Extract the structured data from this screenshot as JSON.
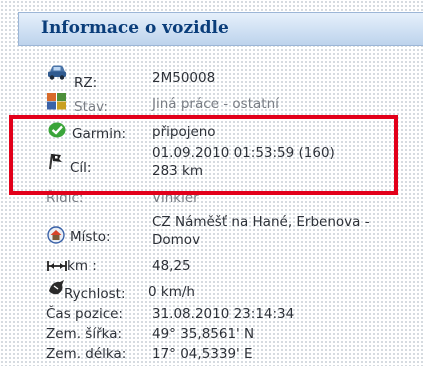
{
  "header": {
    "title": "Informace o vozidle"
  },
  "rows": {
    "rz": {
      "label": "RZ:",
      "value": "2M50008",
      "icon": "car-icon"
    },
    "stav": {
      "label": "Stav:",
      "value": "Jiná práce - ostatní",
      "icon": "status-people-icon"
    },
    "garmin": {
      "label": "Garmin:",
      "value": "připojeno",
      "icon": "check-badge-icon"
    },
    "cil": {
      "label": "Cíl:",
      "value_line1": "01.09.2010 01:53:59 (160)",
      "value_line2": "283 km",
      "icon": "target-flag-icon"
    },
    "ridic": {
      "label": "Řidič:",
      "value": "Vinkler"
    },
    "misto": {
      "label": "Místo:",
      "value_line1": "CZ Náměšť na Hané, Erbenova -",
      "value_line2": "Domov",
      "icon": "home-icon"
    },
    "km": {
      "label": "km :",
      "value": "48,25",
      "icon": "distance-arrows-icon"
    },
    "rychlost": {
      "label": "Rychlost:",
      "value": "0 km/h",
      "icon": "speed-icon"
    },
    "cas_pozice": {
      "label": "Čas pozice:",
      "value": "31.08.2010 23:14:34"
    },
    "zem_sirka": {
      "label": "Zem. šířka:",
      "value": "49° 35,8561' N"
    },
    "zem_delka": {
      "label": "Zem. délka:",
      "value": "17° 04,5339' E"
    }
  },
  "colors": {
    "header_text": "#0a3d7a",
    "highlight_border": "#e2001a",
    "garmin_icon": "#3aa53a"
  }
}
